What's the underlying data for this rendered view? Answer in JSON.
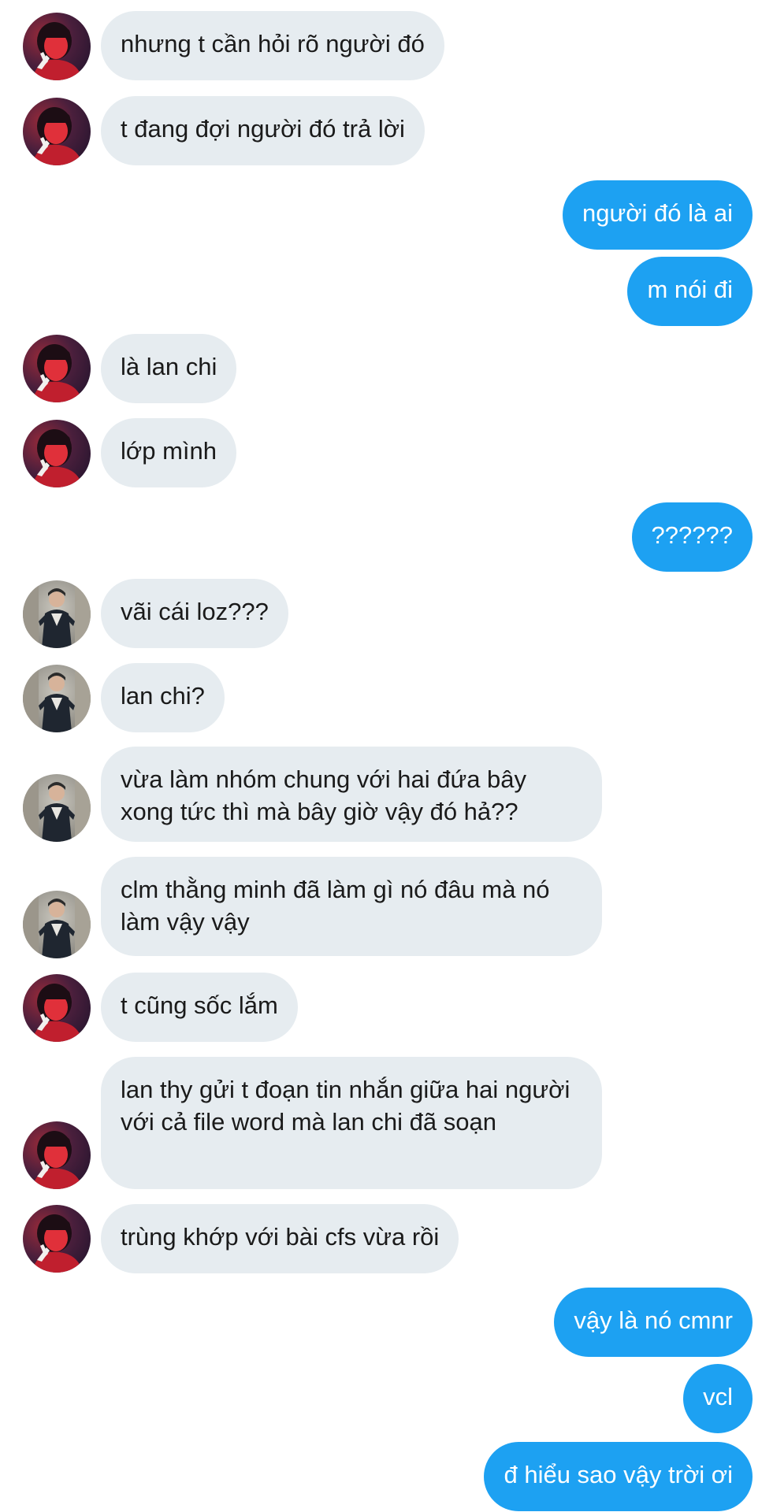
{
  "conversation": {
    "contacts": {
      "girl": {
        "avatar_icon": "girl-red-avatar-icon"
      },
      "guy": {
        "avatar_icon": "guy-outdoor-avatar-icon"
      }
    },
    "colors": {
      "incoming_bubble": "#e6ecf0",
      "outgoing_bubble": "#1da1f2",
      "incoming_text": "#1a1a1a",
      "outgoing_text": "#ffffff"
    },
    "messages": [
      {
        "sender": "girl",
        "direction": "in",
        "text": "nhưng t cần hỏi rõ người đó"
      },
      {
        "sender": "girl",
        "direction": "in",
        "text": "t đang đợi người đó trả lời"
      },
      {
        "sender": "me",
        "direction": "out",
        "text": "người đó là ai"
      },
      {
        "sender": "me",
        "direction": "out",
        "text": "m nói đi"
      },
      {
        "sender": "girl",
        "direction": "in",
        "text": "là lan chi"
      },
      {
        "sender": "girl",
        "direction": "in",
        "text": "lớp mình"
      },
      {
        "sender": "me",
        "direction": "out",
        "text": "??????"
      },
      {
        "sender": "guy",
        "direction": "in",
        "text": "vãi cái loz???"
      },
      {
        "sender": "guy",
        "direction": "in",
        "text": "lan chi?"
      },
      {
        "sender": "guy",
        "direction": "in",
        "text": "vừa làm nhóm chung với hai đứa bây xong tức thì mà bây giờ vậy đó hả??"
      },
      {
        "sender": "guy",
        "direction": "in",
        "text": "clm thằng minh đã làm gì nó đâu mà nó làm vậy vậy"
      },
      {
        "sender": "girl",
        "direction": "in",
        "text": "t cũng sốc lắm"
      },
      {
        "sender": "girl",
        "direction": "in",
        "text": "lan thy gửi t đoạn tin nhắn giữa hai người với cả file word mà lan chi đã soạn"
      },
      {
        "sender": "girl",
        "direction": "in",
        "text": "trùng khớp với bài cfs vừa rồi"
      },
      {
        "sender": "me",
        "direction": "out",
        "text": "vậy là nó cmnr"
      },
      {
        "sender": "me",
        "direction": "out",
        "text": "vcl"
      },
      {
        "sender": "me",
        "direction": "out",
        "text": "đ hiểu sao vậy trời ơi"
      }
    ]
  }
}
